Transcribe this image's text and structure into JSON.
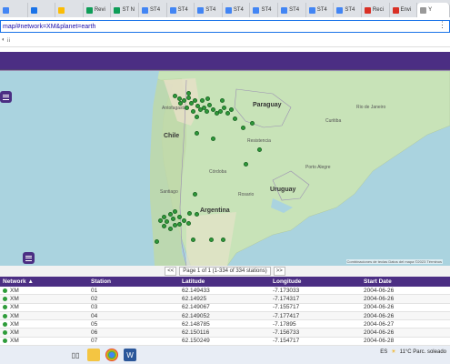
{
  "browser": {
    "tabs": [
      {
        "label": "",
        "color": "#4285f4"
      },
      {
        "label": "",
        "color": "#1a73e8"
      },
      {
        "label": "",
        "color": "#fbbc05"
      },
      {
        "label": "Revi",
        "color": "#0f9d58"
      },
      {
        "label": "ST N",
        "color": "#0f9d58"
      },
      {
        "label": "ST4",
        "color": "#4285f4"
      },
      {
        "label": "ST4",
        "color": "#4285f4"
      },
      {
        "label": "ST4",
        "color": "#4285f4"
      },
      {
        "label": "ST4",
        "color": "#4285f4"
      },
      {
        "label": "ST4",
        "color": "#4285f4"
      },
      {
        "label": "ST4",
        "color": "#4285f4"
      },
      {
        "label": "ST4",
        "color": "#4285f4"
      },
      {
        "label": "ST4",
        "color": "#4285f4"
      },
      {
        "label": "Reci",
        "color": "#d93025"
      },
      {
        "label": "Envi",
        "color": "#d93025"
      },
      {
        "label": "Y",
        "color": "#999999",
        "active": true
      }
    ],
    "url": "map/#network=XM&planet=earth",
    "bookmark_text": "◐ ¡¡"
  },
  "map": {
    "countries": [
      "Chile",
      "Paraguay",
      "Argentina",
      "Uruguay"
    ],
    "cities": [
      "Antofagasta",
      "Resistencia",
      "Santiago",
      "Porto Alegre",
      "Rio de Janeiro",
      "Curitiba",
      "Rosario",
      "Córdoba"
    ],
    "attribution": "Combinaciones de teclas   Datos del mapa ©2023   Términos"
  },
  "pager": {
    "prev": "<<",
    "text": "Page 1 of 1 (1-334 of 334 stations)",
    "next": ">>"
  },
  "table": {
    "headers": [
      "Network ▲",
      "Station",
      "Latitude",
      "Longitude",
      "Start Date"
    ],
    "rows": [
      [
        "XM",
        "01",
        "62.149433",
        "-7.173033",
        "2004-06-26"
      ],
      [
        "XM",
        "02",
        "62.14925",
        "-7.174317",
        "2004-06-26"
      ],
      [
        "XM",
        "03",
        "62.149067",
        "-7.155717",
        "2004-06-26"
      ],
      [
        "XM",
        "04",
        "62.149052",
        "-7.177417",
        "2004-06-26"
      ],
      [
        "XM",
        "05",
        "62.148785",
        "-7.17895",
        "2004-06-27"
      ],
      [
        "XM",
        "06",
        "62.150116",
        "-7.156733",
        "2004-06-26"
      ],
      [
        "XM",
        "07",
        "62.150249",
        "-7.154717",
        "2004-06-28"
      ]
    ]
  },
  "taskbar": {
    "lang": "ES",
    "weather": "11°C  Parc. soleado"
  },
  "colors": {
    "brand": "#4b2e83",
    "station": "#2e9c3a"
  }
}
